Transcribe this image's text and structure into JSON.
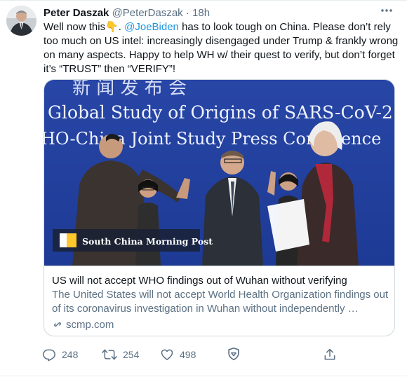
{
  "tweet": {
    "display_name": "Peter Daszak",
    "handle": "@PeterDaszak",
    "separator": " · ",
    "time": "18h",
    "text_part1": "Well now this",
    "emoji": "👇",
    "text_part2": ". ",
    "mention": "@JoeBiden",
    "text_part3": " has to look tough on China. Please don’t rely too much on US intel: increasingly disengaged under Trump & frankly wrong on many aspects. Happy to help WH w/ their quest to verify, but don’t forget it’s “TRUST” then “VERIFY”!"
  },
  "card": {
    "image_banner_line1": "Global Study of Origins of SARS-CoV-2",
    "image_banner_line2": "HO-China Joint Study Press Conference",
    "image_banner_top": "新 闻 发 布 会",
    "watermark": "South China Morning Post",
    "title": "US will not accept WHO findings out of Wuhan without verifying",
    "description": "The United States will not accept World Health Organization findings out of its coronavirus investigation in Wuhan without independently …",
    "domain": "scmp.com"
  },
  "actions": {
    "reply_count": "248",
    "retweet_count": "254",
    "like_count": "498"
  },
  "icons": [
    "more-icon",
    "reply-icon",
    "retweet-icon",
    "like-icon",
    "share-icon",
    "link-icon",
    "scmp-logo-icon"
  ],
  "colors": {
    "link": "#1b95e0",
    "muted": "#5b7083",
    "border": "#cfd9de"
  }
}
